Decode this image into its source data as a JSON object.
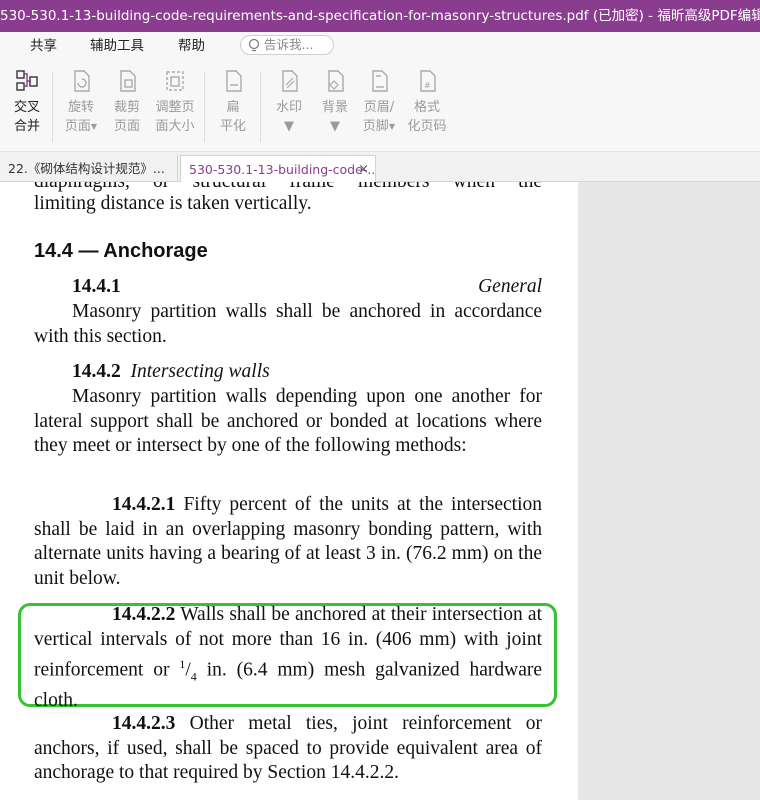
{
  "window": {
    "title": "530-530.1-13-building-code-requirements-and-specification-for-masonry-structures.pdf (已加密) - 福昕高级PDF编辑器"
  },
  "menu": {
    "share": "共享",
    "tools": "辅助工具",
    "help": "帮助",
    "tell_placeholder": "告诉我..."
  },
  "ribbon": {
    "cross_merge": [
      "交叉",
      "合并"
    ],
    "rotate_page": [
      "旋转",
      "页面"
    ],
    "crop_page": [
      "裁剪",
      "页面"
    ],
    "resize_page": [
      "调整页",
      "面大小"
    ],
    "flatten": [
      "扁",
      "平化"
    ],
    "watermark": "水印",
    "background": "背景",
    "header_footer": [
      "页眉/",
      "页脚"
    ],
    "format_page_number": [
      "格式",
      "化页码"
    ]
  },
  "tabs": [
    {
      "label": "22.《砌体结构设计规范》..."
    },
    {
      "label": "530-530.1-13-building-code-...",
      "close": "×"
    }
  ],
  "document": {
    "partial_line": "diaphragms,  or  structural  frame  members  when  the",
    "line_limiting": "limiting distance is taken vertically.",
    "heading": "14.4 — Anchorage",
    "s1_num": "14.4.1",
    "s1_title": "General",
    "s1_text": "Masonry partition walls shall be anchored in accordance with this section.",
    "s2_num": "14.4.2",
    "s2_title": "Intersecting walls",
    "s2_text": "Masonry partition walls depending upon one another for lateral support shall be anchored or bonded at locations where they meet or intersect by one of the following methods:",
    "s21_num": "14.4.2.1",
    "s21_text": "Fifty percent of the units at the intersection shall be laid in an overlapping masonry bonding pattern, with alternate units having a bearing of at least 3 in. (76.2 mm) on the unit below.",
    "s22_num": "14.4.2.2",
    "s22_text_a": "Walls shall be anchored at their intersection at vertical intervals of not more than 16 in. (406 mm) with joint reinforcement or",
    "s22_frac_num": "1",
    "s22_frac_den": "4",
    "s22_text_b": "in. (6.4 mm) mesh galvanized hardware cloth.",
    "s23_num": "14.4.2.3",
    "s23_text": "Other metal ties, joint reinforcement or anchors, if used, shall be spaced to provide equivalent area of anchorage to that required by Section 14.4.2.2."
  },
  "colors": {
    "titlebar": "#8a3d8f",
    "highlight_border": "#35c335",
    "side_panel": "#e6e6e6"
  }
}
